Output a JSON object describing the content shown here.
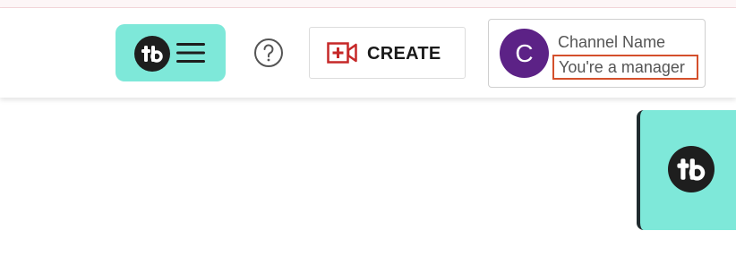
{
  "header": {
    "create_label": "CREATE",
    "channel": {
      "avatar_letter": "C",
      "name": "Channel Name",
      "role": "You're a manager"
    }
  },
  "icons": {
    "menu_logo": "tubebuddy-logo-icon",
    "menu": "hamburger-menu-icon",
    "help": "question-circle-icon",
    "create": "video-add-icon",
    "side_tab": "tubebuddy-logo-icon"
  },
  "colors": {
    "accent_mint": "#7ee8d9",
    "avatar_purple": "#5c2286",
    "create_icon_red": "#c62828",
    "highlight_border": "#d4502c",
    "logo_dark": "#1e1e1e"
  }
}
